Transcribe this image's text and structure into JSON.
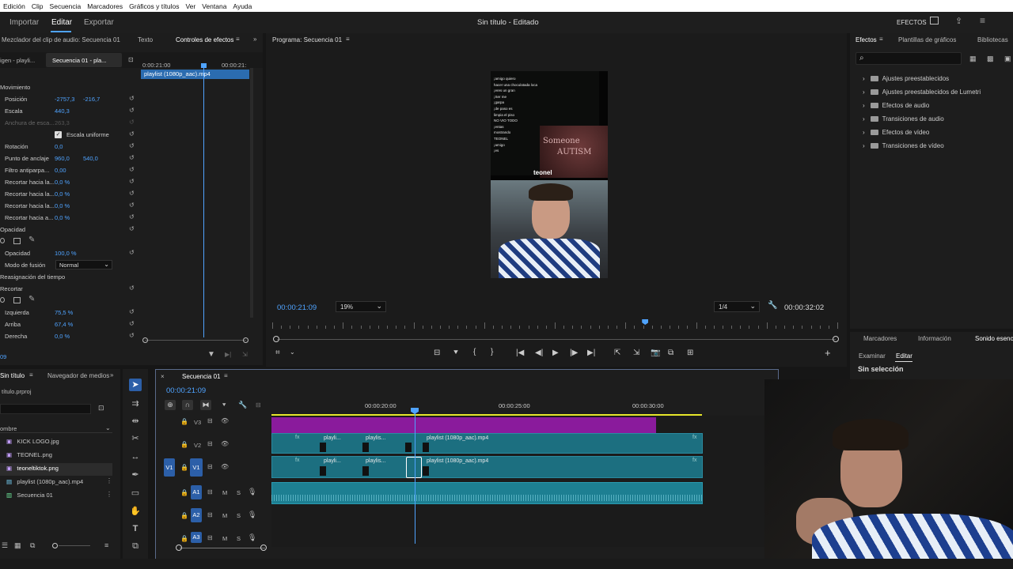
{
  "menu": [
    "Edición",
    "Clip",
    "Secuencia",
    "Marcadores",
    "Gráficos y títulos",
    "Ver",
    "Ventana",
    "Ayuda"
  ],
  "workspace": {
    "tabs": [
      "Importar",
      "Editar",
      "Exportar"
    ],
    "active": "Editar",
    "title": "Sin título - Editado",
    "efectos_label": "EFECTOS"
  },
  "effect_controls": {
    "tabs": [
      "Mezclador del clip de audio: Secuencia 01",
      "Texto",
      "Controles de efectos"
    ],
    "sub_tabs": [
      "igen - playli...",
      "Secuencia 01 - pla..."
    ],
    "ruler": [
      "0:00:21:00",
      "00:00:21:"
    ],
    "clip_name": "playlist (1080p_aac).mp4",
    "timecode": "09",
    "rows": [
      {
        "label": "Movimiento",
        "values": []
      },
      {
        "label": "Posición",
        "values": [
          "-2757,3",
          "-216,7"
        ]
      },
      {
        "label": "Escala",
        "values": [
          "440,3"
        ]
      },
      {
        "label": "Anchura de esca...",
        "values": [
          "263,3"
        ]
      },
      {
        "label": "Escala uniforme",
        "values": []
      },
      {
        "label": "Rotación",
        "values": [
          "0,0"
        ]
      },
      {
        "label": "Punto de anclaje",
        "values": [
          "960,0",
          "540,0"
        ]
      },
      {
        "label": "Filtro antiparpa...",
        "values": [
          "0,00"
        ]
      },
      {
        "label": "Recortar hacia la...",
        "values": [
          "0,0 %"
        ]
      },
      {
        "label": "Recortar hacia la...",
        "values": [
          "0,0 %"
        ]
      },
      {
        "label": "Recortar hacia la...",
        "values": [
          "0,0 %"
        ]
      },
      {
        "label": "Recortar hacia a...",
        "values": [
          "0,0 %"
        ]
      },
      {
        "label": "Opacidad",
        "values": []
      },
      {
        "label": "Opacidad",
        "values": [
          "100,0 %"
        ]
      },
      {
        "label": "Modo de fusión",
        "values": [
          "Normal"
        ]
      },
      {
        "label": "Reasignación del tiempo",
        "values": []
      },
      {
        "label": "Recortar",
        "values": []
      },
      {
        "label": "Izquierda",
        "values": [
          "75,5 %"
        ]
      },
      {
        "label": "Arriba",
        "values": [
          "67,4 %"
        ]
      },
      {
        "label": "Derecha",
        "values": [
          "0,0 %"
        ]
      }
    ]
  },
  "program": {
    "title": "Programa: Secuencia 01",
    "timecode": "00:00:21:09",
    "zoom": "19%",
    "quality": "1/4",
    "duration": "00:00:32:02",
    "playhead_fraction": 0.66,
    "video_text": [
      "¡amigo quiero",
      "hacer una choculatada loca",
      "¡eres un gran",
      "¡Ser me",
      "¡garpa",
      "¡de paso es",
      "limpia el piso",
      "NO VIO TODO",
      "¡entas",
      "mostrando",
      "TEONEL",
      "¡amigo",
      "¡es"
    ],
    "watermark": "teonel",
    "sign_text": [
      "Someone",
      "AUTISM"
    ]
  },
  "right_panel": {
    "tabs": [
      "Efectos",
      "Plantillas de gráficos",
      "Bibliotecas"
    ],
    "folders": [
      "Ajustes preestablecidos",
      "Ajustes preestablecidos de Lumetri",
      "Efectos de audio",
      "Transiciones de audio",
      "Efectos de vídeo",
      "Transiciones de vídeo"
    ],
    "lower_tabs": [
      "Marcadores",
      "Información",
      "Sonido esencial"
    ],
    "sub_tabs": [
      "Examinar",
      "Editar"
    ],
    "status": "Sin selección"
  },
  "project": {
    "tabs": [
      "Sin título",
      "Navegador de medios"
    ],
    "file": "título.prproj",
    "column": "ombre",
    "items": [
      "KICK LOGO.jpg",
      "TEONEL.png",
      "teoneltiktok.png",
      "playlist (1080p_aac).mp4",
      "Secuencia 01"
    ]
  },
  "timeline": {
    "tab": "Secuencia 01",
    "timecode": "00:00:21:09",
    "ruler": [
      "00:00:20:00",
      "00:00:25:00",
      "00:00:30:00"
    ],
    "tracks": [
      "V3",
      "V2",
      "V1",
      "A1",
      "A2",
      "A3"
    ],
    "source_v1": "V1",
    "source_a1": "A1",
    "clip_labels": [
      "playli...",
      "playlis...",
      "playlist (1080p_aac).mp4"
    ],
    "mute": "M",
    "solo": "S"
  },
  "colors": {
    "accent": "#4fa3ff",
    "clip": "#1c6f80",
    "magenta": "#8a1b9c",
    "audio": "#1d7f92",
    "work_area": "#e6e62a"
  }
}
